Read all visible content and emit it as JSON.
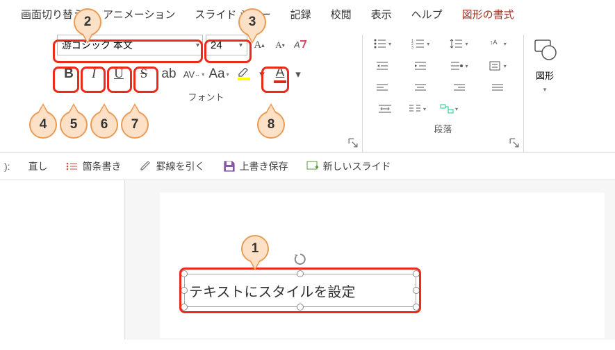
{
  "tabs": {
    "transitions": "画面切り替え",
    "animation": "アニメーション",
    "slideshow": "スライド ショー",
    "record": "記録",
    "review": "校閲",
    "view": "表示",
    "help": "ヘルプ",
    "shapeformat": "図形の書式"
  },
  "font": {
    "name": "游ゴシック 本文",
    "size": "24",
    "group_label": "フォント",
    "bold": "B",
    "italic": "I",
    "underline": "U",
    "strike": "S",
    "case": "Aa"
  },
  "paragraph": {
    "group_label": "段落"
  },
  "shapes": {
    "label": "図形"
  },
  "qat": {
    "redo_suffix": "直し",
    "bullets": "箇条書き",
    "borders": "罫線を引く",
    "save": "上書き保存",
    "newslide": "新しいスライド"
  },
  "textbox": {
    "content": "テキストにスタイルを設定"
  },
  "callouts": {
    "c1": "1",
    "c2": "2",
    "c3": "3",
    "c4": "4",
    "c5": "5",
    "c6": "6",
    "c7": "7",
    "c8": "8"
  }
}
